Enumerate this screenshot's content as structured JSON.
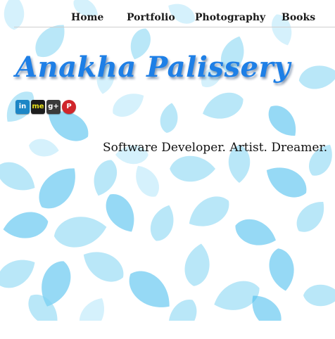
{
  "nav": {
    "items": [
      {
        "label": "Home"
      },
      {
        "label": "Portfolio"
      },
      {
        "label": "Photography"
      },
      {
        "label": "Books"
      }
    ]
  },
  "header": {
    "title": "Anakha Palissery",
    "title_color": "#1e7fe6"
  },
  "social": {
    "icons": [
      {
        "name": "linkedin-icon",
        "glyph": "in",
        "color": "#1c86c6"
      },
      {
        "name": "behance-icon",
        "glyph": "me",
        "color": "#1d1d1d",
        "text_color": "#e8e21a"
      },
      {
        "name": "google-plus-icon",
        "glyph": "g+",
        "color": "#3a3a3a"
      },
      {
        "name": "pinterest-icon",
        "glyph": "P",
        "color": "#d0262b"
      }
    ]
  },
  "tagline": "Software Developer. Artist. Dreamer.",
  "colors": {
    "leaf": "#7fd4f3",
    "background": "#ffffff"
  }
}
